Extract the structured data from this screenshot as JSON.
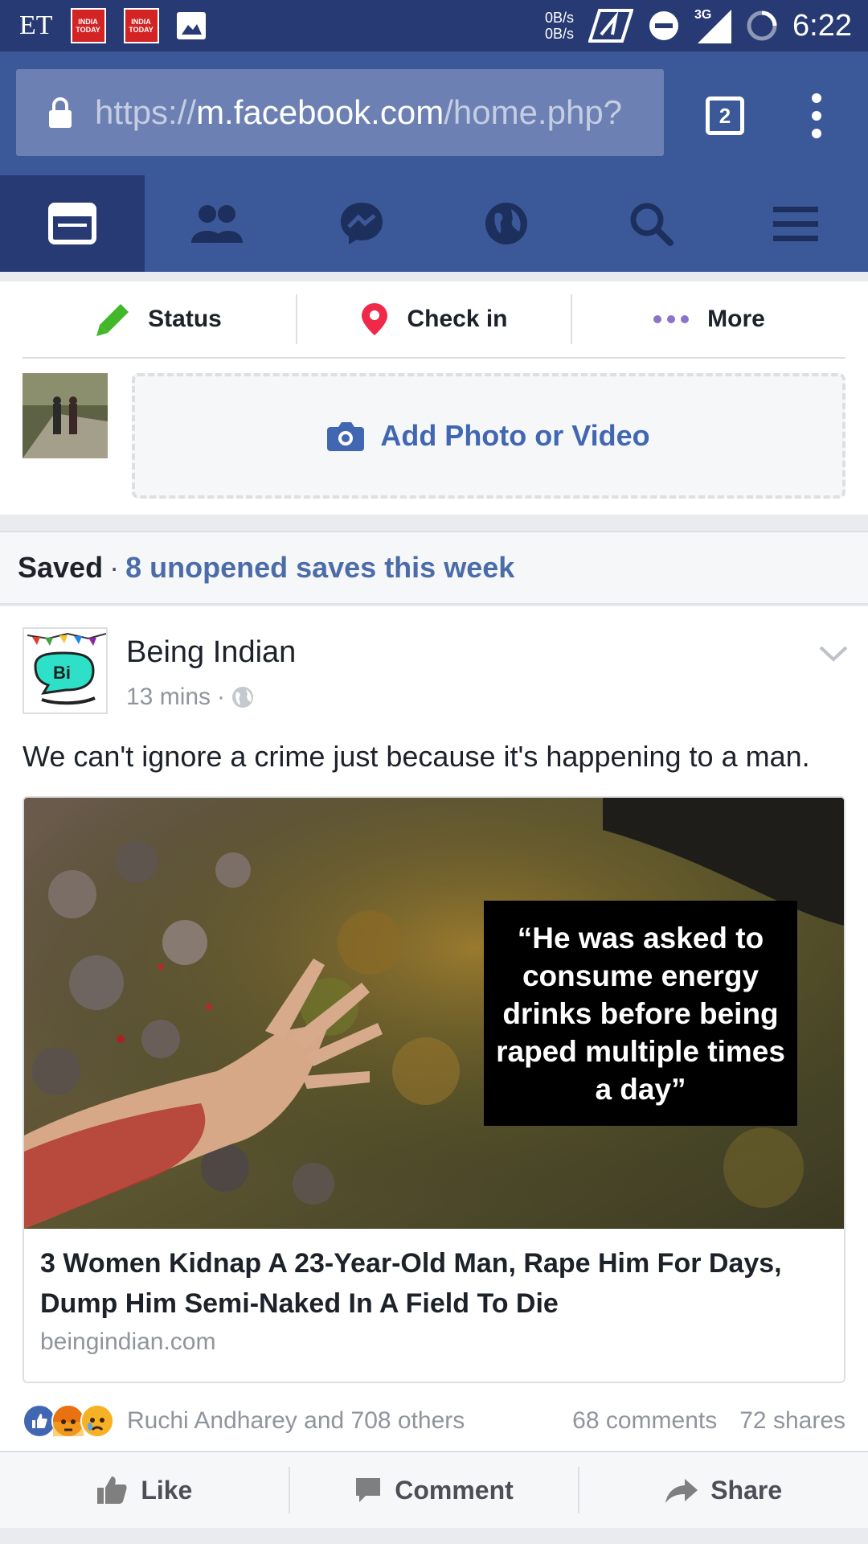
{
  "status_bar": {
    "left_app": "ET",
    "news_badge": "INDIA TODAY",
    "speed_up": "0B/s",
    "speed_down": "0B/s",
    "network": "3G",
    "time": "6:22"
  },
  "url_bar": {
    "scheme": "https://",
    "host": "m.facebook.com",
    "path": "/home.php?",
    "tab_count": "2"
  },
  "nav": {
    "items": [
      "news-feed-icon",
      "friends-icon",
      "messenger-icon",
      "notifications-globe-icon",
      "search-icon",
      "menu-icon"
    ],
    "active_index": 0
  },
  "composer": {
    "status_label": "Status",
    "checkin_label": "Check in",
    "more_label": "More",
    "add_photo_label": "Add Photo or Video"
  },
  "saved": {
    "label": "Saved",
    "separator": "·",
    "count_text": "8 unopened saves this week"
  },
  "post": {
    "author": "Being Indian",
    "time": "13 mins",
    "meta_sep": "·",
    "text": "We can't ignore a crime just because it's happening to a man.",
    "image_quote": "“He was asked to consume energy drinks before being raped multiple times a day”",
    "link_title": "3 Women Kidnap A 23-Year-Old Man, Rape Him For Days, Dump Him Semi-Naked In A Field To Die",
    "link_domain": "beingindian.com",
    "reactions_text": "Ruchi Andharey and 708 others",
    "comments": "68 comments",
    "shares": "72 shares",
    "like_label": "Like",
    "comment_label": "Comment",
    "share_label": "Share"
  },
  "colors": {
    "fb_blue": "#3b5998",
    "fb_dark": "#283a73",
    "link_blue": "#4267b2",
    "status_green": "#42b72a",
    "checkin_pink": "#f02849",
    "more_purple": "#8c72cb"
  }
}
